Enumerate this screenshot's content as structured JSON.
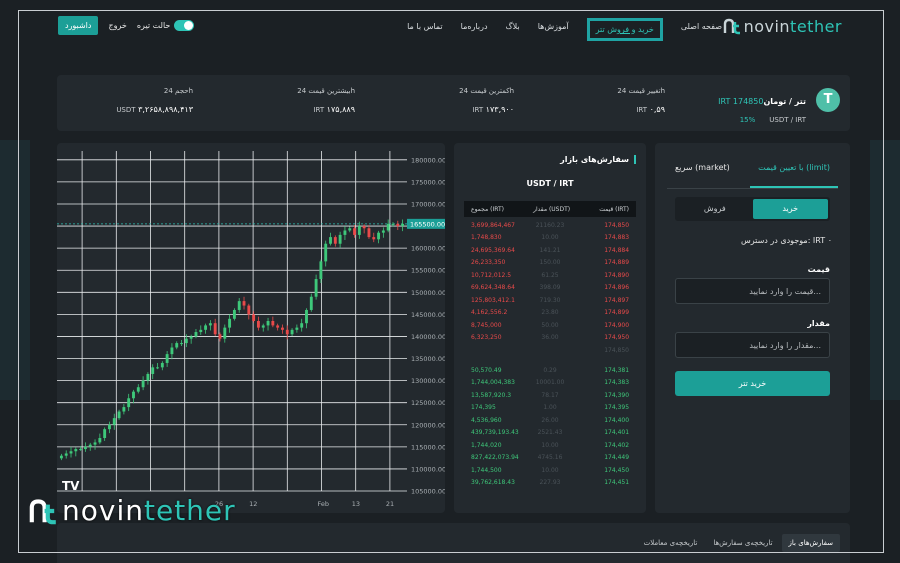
{
  "brand": {
    "prefix": "novin",
    "suffix": "tether"
  },
  "nav": {
    "menu": [
      {
        "label": "صفحه اصلی",
        "active": false
      },
      {
        "label": "خرید و فروش تتر",
        "active": true
      },
      {
        "label": "آموزش‌ها",
        "active": false
      },
      {
        "label": "بلاگ",
        "active": false
      },
      {
        "label": "درباره‌ما",
        "active": false
      },
      {
        "label": "تماس با ما",
        "active": false
      }
    ],
    "dashboard": "داشبورد",
    "logout": "خروج",
    "dark_mode": "حالت تیره"
  },
  "ticker": {
    "pair": "تتر / تومان",
    "price": "IRT 174850",
    "symbol": "USDT / IRT",
    "percent": "15%",
    "stats": [
      {
        "label": "تغییر قیمت 24h",
        "value": "۰,۵۹",
        "unit": "IRT"
      },
      {
        "label": "کمترین قیمت 24h",
        "value": "۱۷۳,۹۰۰",
        "unit": "IRT"
      },
      {
        "label": "بیشترین قیمت 24h",
        "value": "۱۷۵,۸۸۹",
        "unit": "IRT"
      },
      {
        "label": "حجم 24h",
        "value": "۳,۲۶۵۸,۸۹۸,۴۱۳",
        "unit": "USDT"
      }
    ]
  },
  "chart_data": {
    "type": "candlestick",
    "ylim": [
      105000,
      182000
    ],
    "y_ticks": [
      "180000.00",
      "175000.00",
      "170000.00",
      "165000.00",
      "160000.00",
      "155000.00",
      "150000.00",
      "145000.00",
      "140000.00",
      "135000.00",
      "130000.00",
      "125000.00",
      "120000.00",
      "115000.00",
      "110000.00",
      "105000.00"
    ],
    "x_ticks": [
      "",
      "",
      "",
      "",
      "26",
      "12",
      "",
      "Feb",
      "13",
      "21"
    ],
    "current_price_label": "165500.00",
    "current_price": 165500,
    "close": [
      113000,
      113500,
      114000,
      114500,
      114500,
      115000,
      115500,
      116000,
      117000,
      119000,
      120000,
      121500,
      123000,
      124000,
      126000,
      127500,
      128500,
      130000,
      131500,
      133000,
      133000,
      134000,
      136000,
      137500,
      138500,
      138500,
      139500,
      140000,
      141000,
      141500,
      142500,
      143000,
      140500,
      139500,
      142000,
      144000,
      146000,
      148000,
      147000,
      145000,
      143500,
      142000,
      142500,
      143500,
      142500,
      142000,
      141500,
      140500,
      141500,
      142000,
      143000,
      146000,
      149000,
      153000,
      157000,
      161000,
      162500,
      161000,
      163000,
      164000,
      164500,
      163000,
      165000,
      164500,
      162500,
      162000,
      163500,
      164000,
      165500,
      165500,
      165000,
      165500
    ]
  },
  "orderbook": {
    "title": "سفارش‌های بازار",
    "pair": "USDT / IRT",
    "headers": {
      "total": "مجموع (IRT)",
      "amount": "مقدار (USDT)",
      "price": "قیمت (IRT)"
    },
    "asks": [
      {
        "total": "3,699,864,467",
        "amount": "21160.23",
        "price": "174,850"
      },
      {
        "total": "1,748,830",
        "amount": "10.00",
        "price": "174,883"
      },
      {
        "total": "24,695,369.64",
        "amount": "141.21",
        "price": "174,884"
      },
      {
        "total": "26,233,350",
        "amount": "150.00",
        "price": "174,889"
      },
      {
        "total": "10,712,012.5",
        "amount": "61.25",
        "price": "174,890"
      },
      {
        "total": "69,624,348.64",
        "amount": "398.09",
        "price": "174,896"
      },
      {
        "total": "125,803,412.1",
        "amount": "719.30",
        "price": "174,897"
      },
      {
        "total": "4,162,556.2",
        "amount": "23.80",
        "price": "174,899"
      },
      {
        "total": "8,745,000",
        "amount": "50.00",
        "price": "174,900"
      },
      {
        "total": "6,323,250",
        "amount": "36.00",
        "price": "174,950"
      }
    ],
    "mid": "174,850",
    "bids": [
      {
        "total": "50,570.49",
        "amount": "0.29",
        "price": "174,381"
      },
      {
        "total": "1,744,004,383",
        "amount": "10001.00",
        "price": "174,383"
      },
      {
        "total": "13,587,920.3",
        "amount": "78.17",
        "price": "174,390"
      },
      {
        "total": "174,395",
        "amount": "1.00",
        "price": "174,395"
      },
      {
        "total": "4,536,960",
        "amount": "26.00",
        "price": "174,400"
      },
      {
        "total": "439,739,193.43",
        "amount": "2521.43",
        "price": "174,401"
      },
      {
        "total": "1,744,020",
        "amount": "10.00",
        "price": "174,402"
      },
      {
        "total": "827,422,073.94",
        "amount": "4745.16",
        "price": "174,449"
      },
      {
        "total": "1,744,500",
        "amount": "10.00",
        "price": "174,450"
      },
      {
        "total": "39,762,618.43",
        "amount": "227.93",
        "price": "174,451"
      }
    ]
  },
  "trade": {
    "tab_limit": "با تعیین قیمت (limit)",
    "tab_market": "سریع (market)",
    "buy": "خرید",
    "sell": "فروش",
    "balance": "موجودی در دسترس: IRT ۰",
    "price_label": "قیمت",
    "price_placeholder": "قیمت را وارد نمایید...",
    "amount_label": "مقدار",
    "amount_placeholder": "مقدار را وارد نمایید...",
    "submit": "خرید تتر"
  },
  "bottom_tabs": [
    {
      "label": "سفارش‌های باز",
      "active": true
    },
    {
      "label": "تاریخچه‌ی سفارش‌ها",
      "active": false
    },
    {
      "label": "تاریخچه‌ی معاملات",
      "active": false
    }
  ],
  "tv_logo": "TV",
  "colors": {
    "accent": "#2ec4b6",
    "button": "#1c9f97",
    "ask": "#e84a4a",
    "bid": "#3ec87a",
    "panel": "#23292e",
    "bg": "#1b2024"
  }
}
